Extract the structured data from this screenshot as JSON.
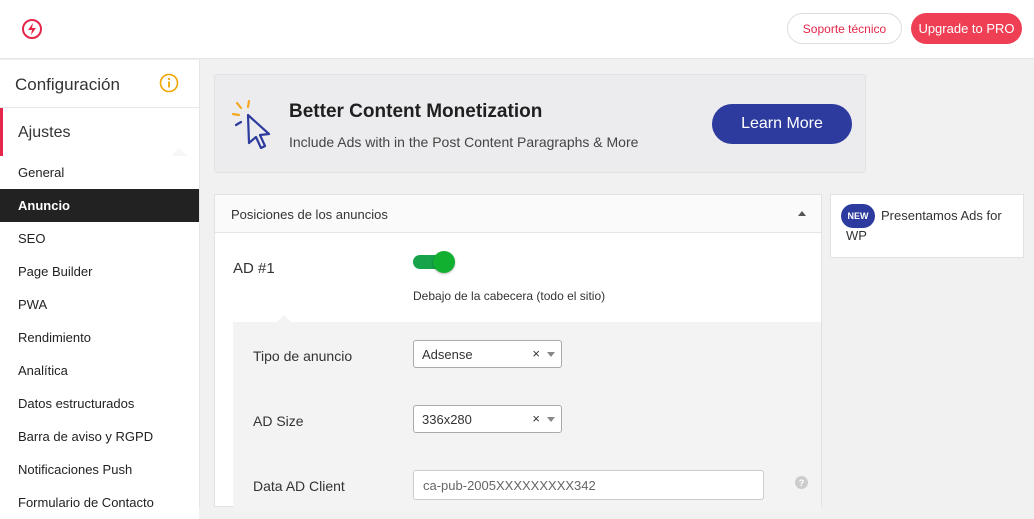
{
  "header": {
    "support_label": "Soporte técnico",
    "upgrade_label": "Upgrade to PRO",
    "logo_icon": "bolt-circle-icon",
    "brand_color": "#e3264a"
  },
  "sidebar": {
    "title": "Configuración",
    "section": "Ajustes",
    "active_color": "#222222",
    "items": [
      {
        "label": "General"
      },
      {
        "label": "Anuncio"
      },
      {
        "label": "SEO"
      },
      {
        "label": "Page Builder"
      },
      {
        "label": "PWA"
      },
      {
        "label": "Rendimiento"
      },
      {
        "label": "Analítica"
      },
      {
        "label": "Datos estructurados"
      },
      {
        "label": "Barra de aviso y RGPD"
      },
      {
        "label": "Notificaciones Push"
      },
      {
        "label": "Formulario de Contacto"
      }
    ],
    "active_item": "Anuncio"
  },
  "promo": {
    "title": "Better Content Monetization",
    "subtitle": "Include Ads with in the Post Content Paragraphs & More",
    "button_label": "Learn More",
    "icon": "cursor-click-icon"
  },
  "panel": {
    "title": "Posiciones de los anuncios",
    "ad_label": "AD #1",
    "toggle_on": true,
    "toggle_desc": "Debajo de la cabecera (todo el sitio)",
    "fields": {
      "ad_type_label": "Tipo de anuncio",
      "ad_type_value": "Adsense",
      "ad_size_label": "AD Size",
      "ad_size_value": "336x280",
      "client_label": "Data AD Client",
      "client_value": "ca-pub-2005XXXXXXXXX342"
    },
    "clear_glyph": "×",
    "help_glyph": "?"
  },
  "news": {
    "badge": "NEW",
    "text": "Presentamos Ads for WP"
  }
}
